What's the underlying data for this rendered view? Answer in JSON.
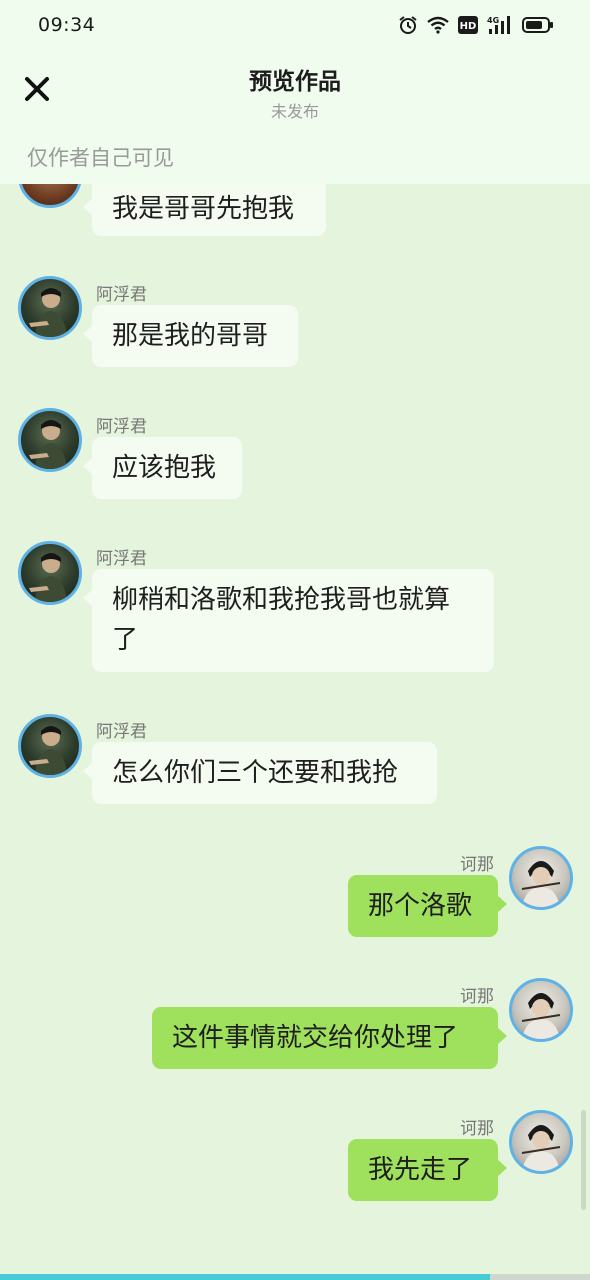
{
  "status_bar": {
    "time": "09:34",
    "hd_label": "HD",
    "network_label": "4G"
  },
  "header": {
    "title": "预览作品",
    "subtitle": "未发布",
    "visibility_note": "仅作者自己可见"
  },
  "messages": [
    {
      "side": "left",
      "sender": "",
      "text": "我是哥哥先抱我"
    },
    {
      "side": "left",
      "sender": "阿浮君",
      "text": "那是我的哥哥"
    },
    {
      "side": "left",
      "sender": "阿浮君",
      "text": "应该抱我"
    },
    {
      "side": "left",
      "sender": "阿浮君",
      "text": "柳稍和洛歌和我抢我哥也就算了"
    },
    {
      "side": "left",
      "sender": "阿浮君",
      "text": "怎么你们三个还要和我抢"
    },
    {
      "side": "right",
      "sender": "诃那",
      "text": "那个洛歌"
    },
    {
      "side": "right",
      "sender": "诃那",
      "text": "这件事情就交给你处理了"
    },
    {
      "side": "right",
      "sender": "诃那",
      "text": "我先走了"
    }
  ],
  "progress": {
    "fraction": 0.83
  },
  "colors": {
    "incoming_bubble": "#f4fbf1",
    "outgoing_bubble": "#9fe05c",
    "avatar_ring": "#5fb2e6",
    "background": "#e5f4dc"
  }
}
